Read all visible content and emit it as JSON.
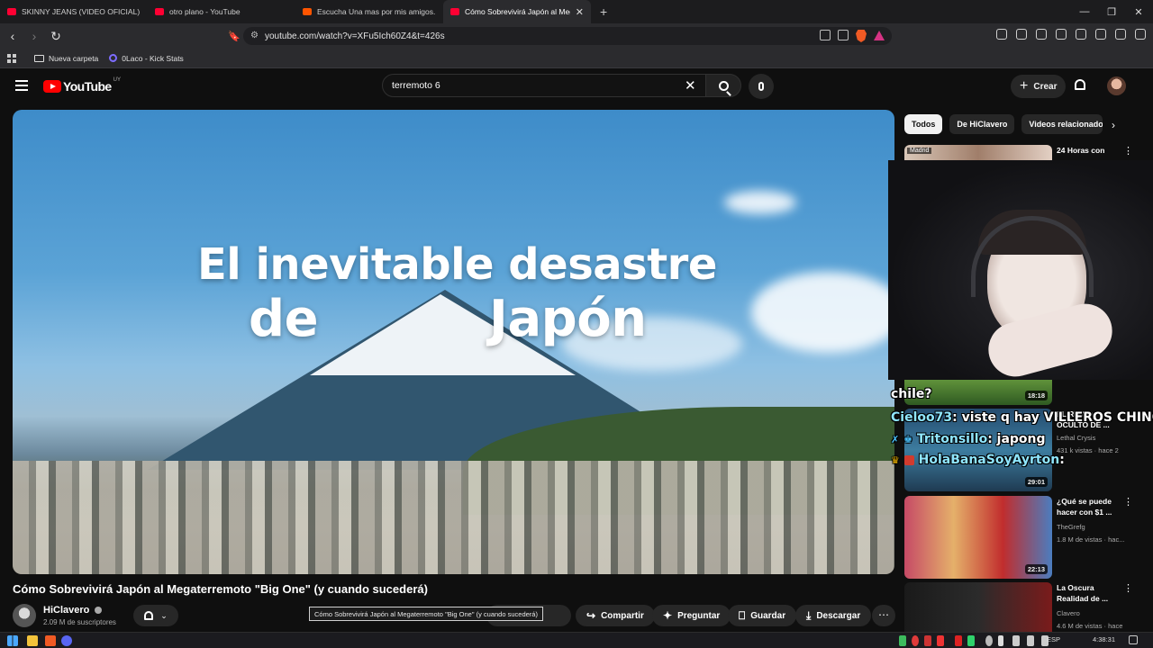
{
  "browser": {
    "tabs": [
      {
        "title": "SKINNY JEANS (VIDEO OFICIAL) - Yo",
        "favicon_color": "#ff0033"
      },
      {
        "title": "otro plano - YouTube",
        "favicon_color": "#ff0033"
      },
      {
        "title": "Escucha Una mas por mis amigos. Pr",
        "favicon_color": "#ff5500"
      },
      {
        "title": "Cómo Sobrevivirá Japón al Meg",
        "favicon_color": "#ff0033"
      }
    ],
    "url": "youtube.com/watch?v=XFu5Ich60Z4&t=426s",
    "bookmarks": [
      "Nueva carpeta",
      "0Laco - Kick Stats"
    ]
  },
  "youtube": {
    "logo_text": "YouTube",
    "country_code": "UY",
    "search_value": "terremoto 6",
    "create_label": "Crear"
  },
  "video": {
    "overlay_line_1": "El inevitable desastre",
    "overlay_line_2": "de          Japón",
    "title": "Cómo Sobrevivirá Japón al Megaterremoto \"Big One\" (y cuando sucederá)",
    "channel": "HiClavero",
    "subscribers": "2.09 M de suscriptores",
    "tooltip": "Cómo Sobrevivirá Japón al Megaterremoto \"Big One\" (y cuando sucederá)",
    "actions": {
      "share": "Compartir",
      "ask": "Preguntar",
      "save": "Guardar",
      "download": "Descargar"
    }
  },
  "sidebar": {
    "chips": [
      "Todos",
      "De HiClavero",
      "Videos relacionados"
    ],
    "items": [
      {
        "title": "24 Horas con",
        "location_tag": "Madrid",
        "channel": "",
        "meta": "",
        "duration": ""
      },
      {
        "title": "",
        "channel": "",
        "meta": "",
        "duration": "18:18"
      },
      {
        "title": "EL REINO OCULTO DE ...",
        "channel": "Lethal Crysis",
        "meta": "431 k vistas · hace 2",
        "duration": "29:01"
      },
      {
        "title": "¿Qué se puede hacer con $1 ...",
        "channel": "TheGrefg",
        "meta": "1.8 M de vistas · hac...",
        "duration": "22:13"
      },
      {
        "title": "La Oscura Realidad de ...",
        "channel": "Clavero",
        "meta": "4.6 M de vistas · hace",
        "duration": ""
      }
    ]
  },
  "chat": {
    "line0": "chile?",
    "messages": [
      {
        "user": "Cieloo73",
        "text": ": viste q hay VILLEROS CHINOS?"
      },
      {
        "user": "Tritonsillo",
        "text": ": japong"
      },
      {
        "user": "HolaBanaSoyAyrton",
        "text": ":"
      }
    ]
  },
  "taskbar": {
    "language": "ESP",
    "time": "4:38:31"
  }
}
